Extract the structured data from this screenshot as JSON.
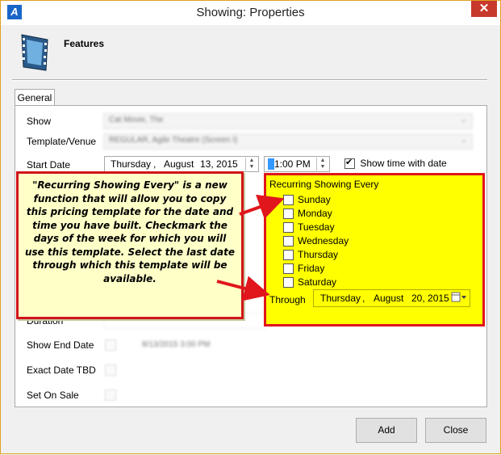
{
  "window": {
    "title": "Showing: Properties",
    "app_icon": "A",
    "close_glyph": "✕"
  },
  "header": {
    "title": "Features"
  },
  "tabs": [
    {
      "label": "General"
    }
  ],
  "form": {
    "show_label": "Show",
    "template_label": "Template/Venue",
    "start_date_label": "Start Date",
    "start_date": {
      "weekday": "Thursday",
      "sep1": ",",
      "month": "August",
      "day_year": "13, 2015"
    },
    "start_time": "1:00 PM",
    "show_time_label": "Show time with date",
    "show_time_checked": true,
    "duration_label": "Duration",
    "show_end_date_label": "Show End Date",
    "exact_date_label": "Exact Date TBD",
    "set_on_sale_label": "Set On Sale"
  },
  "recurring": {
    "title": "Recurring Showing Every",
    "days": [
      "Sunday",
      "Monday",
      "Tuesday",
      "Wednesday",
      "Thursday",
      "Friday",
      "Saturday"
    ],
    "through_label": "Through",
    "through_date": {
      "weekday": "Thursday",
      "sep1": ",",
      "month": "August",
      "day_year": "20, 2015"
    }
  },
  "callout": {
    "text": "\"Recurring Showing Every\" is a new function that will allow you to copy this pricing template for the date and time you have built. Checkmark the days of the week for which you will use this template. Select the last date through which this template will be available."
  },
  "buttons": {
    "add": "Add",
    "close": "Close"
  },
  "colors": {
    "highlight_yellow": "#ffff00",
    "callout_border": "#d0141a",
    "arrow_red": "#e0161c"
  }
}
